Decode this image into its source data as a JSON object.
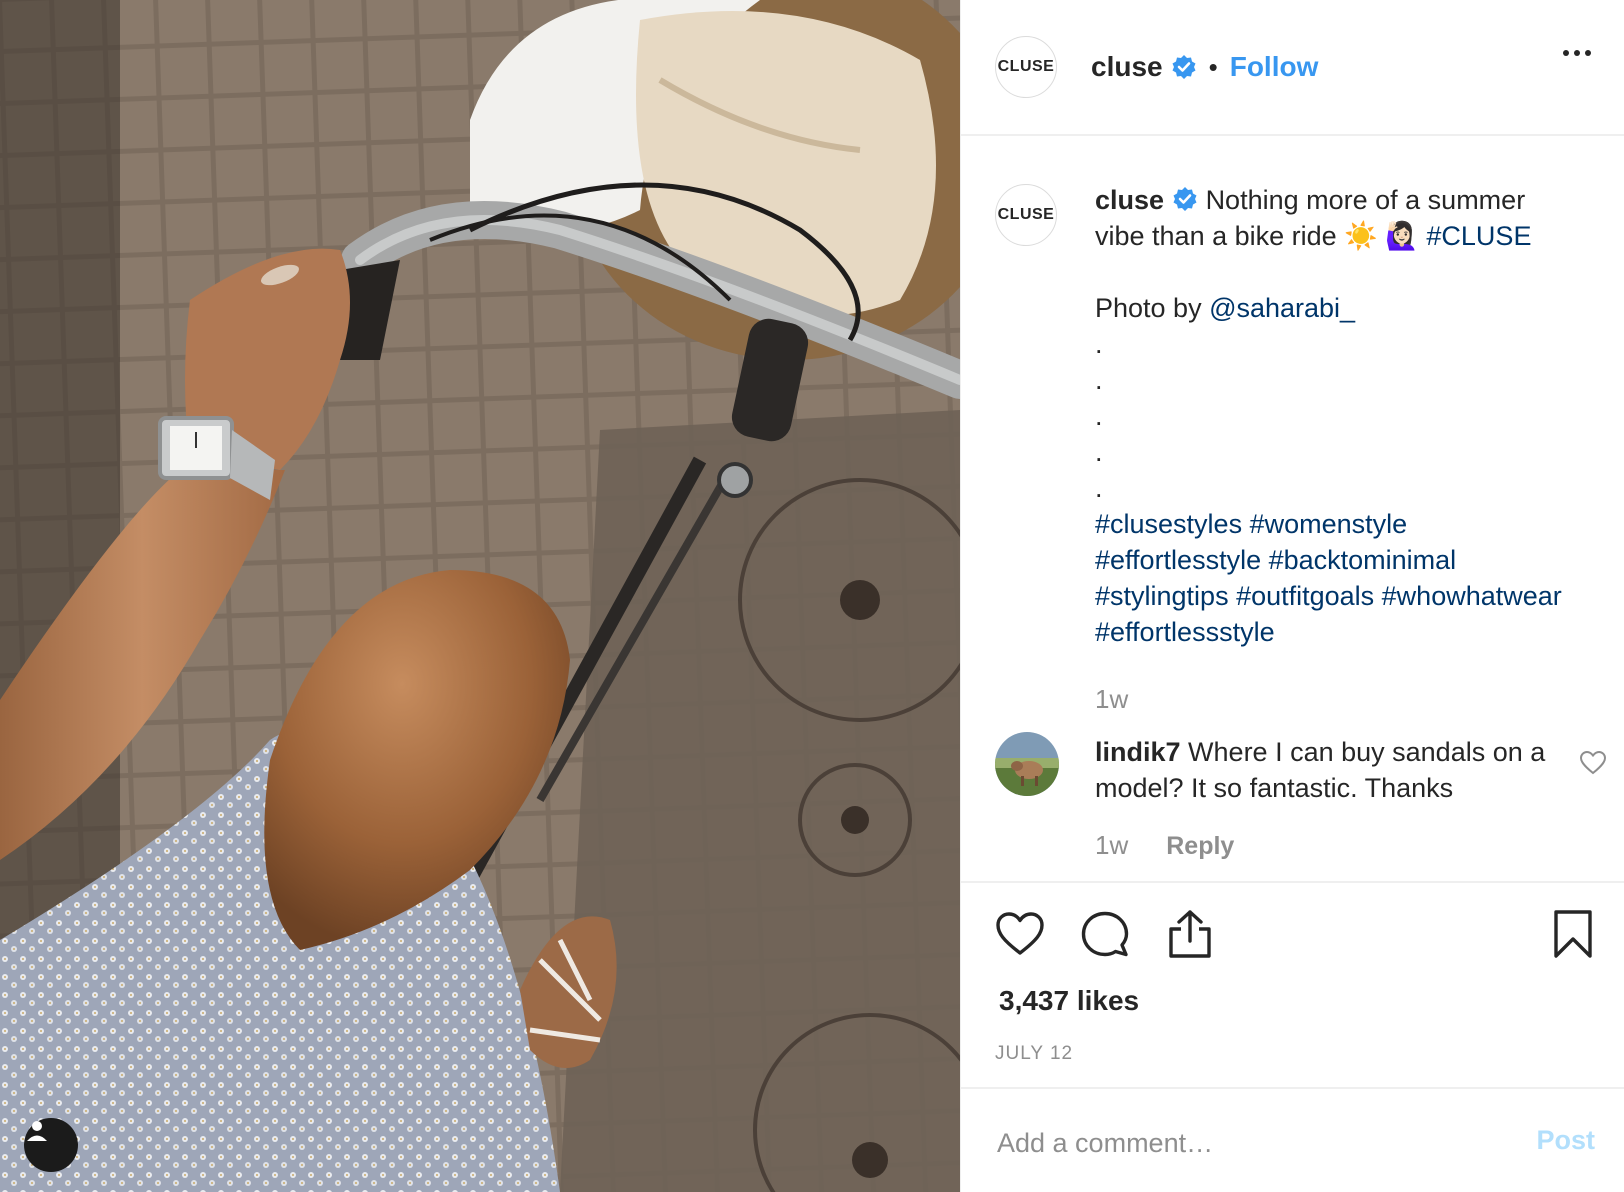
{
  "post": {
    "username": "cluse",
    "brand_avatar_text": "CLUSE",
    "separator": "•",
    "follow_label": "Follow",
    "caption": {
      "username": "cluse",
      "line1": "Nothing more of a summer vibe than a bike ride ☀️ 🙋🏻‍♀️ ",
      "tag_cluse": "#CLUSE",
      "photo_by": "Photo by ",
      "photo_by_handle": "@saharabi_",
      "dots": ".\n.\n.\n.\n.",
      "hashtags": "#clusestyles #womenstyle #effortlesstyle #backtominimal #stylingtips #outfitgoals #whowhatwear #effortlessstyle",
      "time": "1w"
    },
    "comment": {
      "username": "lindik7",
      "text": "Where I can buy sandals on a model? It so fantastic. Thanks",
      "time": "1w",
      "reply_label": "Reply"
    },
    "likes": "3,437 likes",
    "date": "JULY 12",
    "add_comment_placeholder": "Add a comment…",
    "post_label": "Post"
  },
  "colors": {
    "accent": "#3897f0",
    "hashtag": "#003569",
    "muted": "#8e8e8e",
    "post_disabled": "#b2dffc"
  },
  "icons": [
    "verified-badge-icon",
    "more-options-icon",
    "heart-icon",
    "comment-icon",
    "share-icon",
    "bookmark-icon",
    "user-tag-icon"
  ]
}
